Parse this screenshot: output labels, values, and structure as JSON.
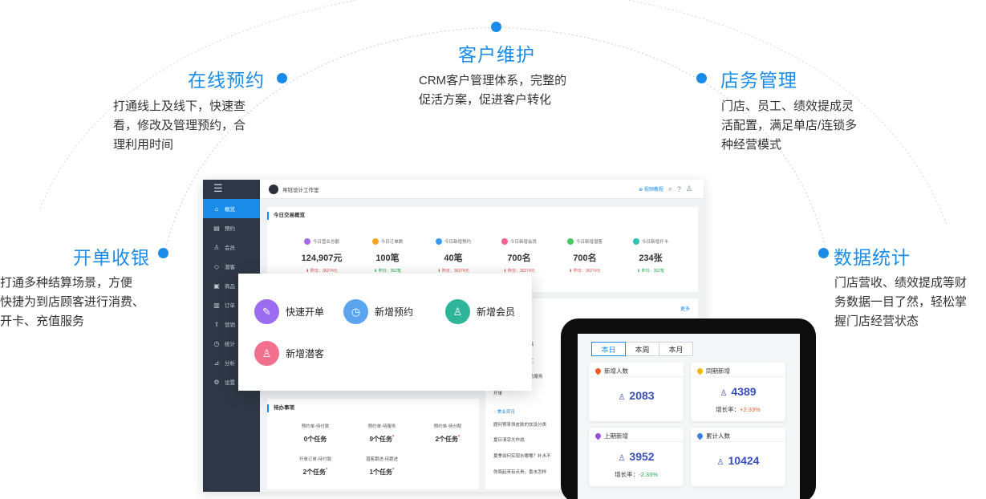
{
  "features": [
    {
      "title": "在线预约",
      "desc": [
        "打通线上及线下，快速查",
        "看，修改及管理预约，合",
        "理利用时间"
      ]
    },
    {
      "title": "客户维护",
      "desc": [
        "CRM客户管理体系，完整的",
        "促活方案，促进客户转化"
      ]
    },
    {
      "title": "店务管理",
      "desc": [
        "门店、员工、绩效提成灵",
        "活配置，满足单店/连锁多",
        "种经营模式"
      ]
    },
    {
      "title": "开单收银",
      "desc": [
        "打通多种结算场景，方便",
        "快捷为到店顾客进行消费、",
        "开卡、充值服务"
      ]
    },
    {
      "title": "数据统计",
      "desc": [
        "门店营收、绩效提成等财",
        "务数据一目了然，轻松掌",
        "握门店经营状态"
      ]
    }
  ],
  "dashboard": {
    "store_name": "帛钰设计工作室",
    "top_link": "视频教程",
    "sidebar": [
      "概览",
      "预约",
      "会员",
      "潜客",
      "商品",
      "订单",
      "营销",
      "统计",
      "分析",
      "设置"
    ],
    "sidebar_icons": [
      "⌂",
      "▤",
      "♙",
      "◇",
      "▣",
      "▥",
      "⇪",
      "◷",
      "⊿",
      "⚙"
    ],
    "summary_title": "今日交易概览",
    "stats": [
      {
        "label": "今日营业总额",
        "value": "124,907元",
        "yesterday": "昨日：36274元",
        "color": "#a66be8",
        "trend": "up"
      },
      {
        "label": "今日订单数",
        "value": "100笔",
        "yesterday": "昨日：362笔",
        "color": "#f5a623",
        "trend": "down"
      },
      {
        "label": "今日新增预约",
        "value": "40笔",
        "yesterday": "昨日：36274元",
        "color": "#3b9bef",
        "trend": "up"
      },
      {
        "label": "今日新增会员",
        "value": "700名",
        "yesterday": "昨日：36274元",
        "color": "#f2648a",
        "trend": "up"
      },
      {
        "label": "今日新增潜客",
        "value": "700名",
        "yesterday": "昨日：36274元",
        "color": "#4cc764",
        "trend": "up"
      },
      {
        "label": "今日新增开卡",
        "value": "234张",
        "yesterday": "昨日：362笔",
        "color": "#2ec3b0",
        "trend": "down"
      }
    ],
    "more_link": "更多",
    "todo_title": "待办事项",
    "todos": [
      {
        "label": "预约单-待付款",
        "value": "0个任务",
        "flag": ""
      },
      {
        "label": "预约单-待服务",
        "value": "9个任务",
        "flag": "*"
      },
      {
        "label": "预约单-待分配",
        "value": "2个任务",
        "flag": "*"
      },
      {
        "label": "开单订单-待付款",
        "value": "2个任务",
        "flag": "*"
      },
      {
        "label": "潜客跟进-待跟进",
        "value": "1个任务",
        "flag": "*"
      }
    ],
    "right_frag": [
      "店",
      "工",
      "约服务",
      "开单"
    ],
    "beauty_title": "美业资讯",
    "news": [
      "题何预来领皮肤的饮设分类",
      "夏日清凉大作战",
      "夏季如何实现水嘟嘟？补水不",
      "你周起来有点贵，香水怎样"
    ]
  },
  "quick": [
    {
      "label": "快速开单",
      "color": "#9b6cf0",
      "icon": "✎"
    },
    {
      "label": "新增预约",
      "color": "#5aa4f0",
      "icon": "◷"
    },
    {
      "label": "新增会员",
      "color": "#2fb59a",
      "icon": "♙"
    },
    {
      "label": "新增潜客",
      "color": "#f2708e",
      "icon": "♙"
    }
  ],
  "tablet": {
    "tabs": [
      "本日",
      "本周",
      "本月"
    ],
    "cards": [
      {
        "title": "新增人数",
        "value": "2083",
        "growth_label": "",
        "growth": "",
        "trend": "",
        "pin": "#f05a28"
      },
      {
        "title": "同期新增",
        "value": "4389",
        "growth_label": "增长率：",
        "growth": "+2.33%",
        "trend": "up",
        "pin": "#f5b50a"
      },
      {
        "title": "上期新增",
        "value": "3952",
        "growth_label": "增长率：",
        "growth": "-2.33%",
        "trend": "down",
        "pin": "#9b4fd6"
      },
      {
        "title": "累计人数",
        "value": "10424",
        "growth_label": "",
        "growth": "",
        "trend": "",
        "pin": "#3a80e8"
      }
    ]
  }
}
